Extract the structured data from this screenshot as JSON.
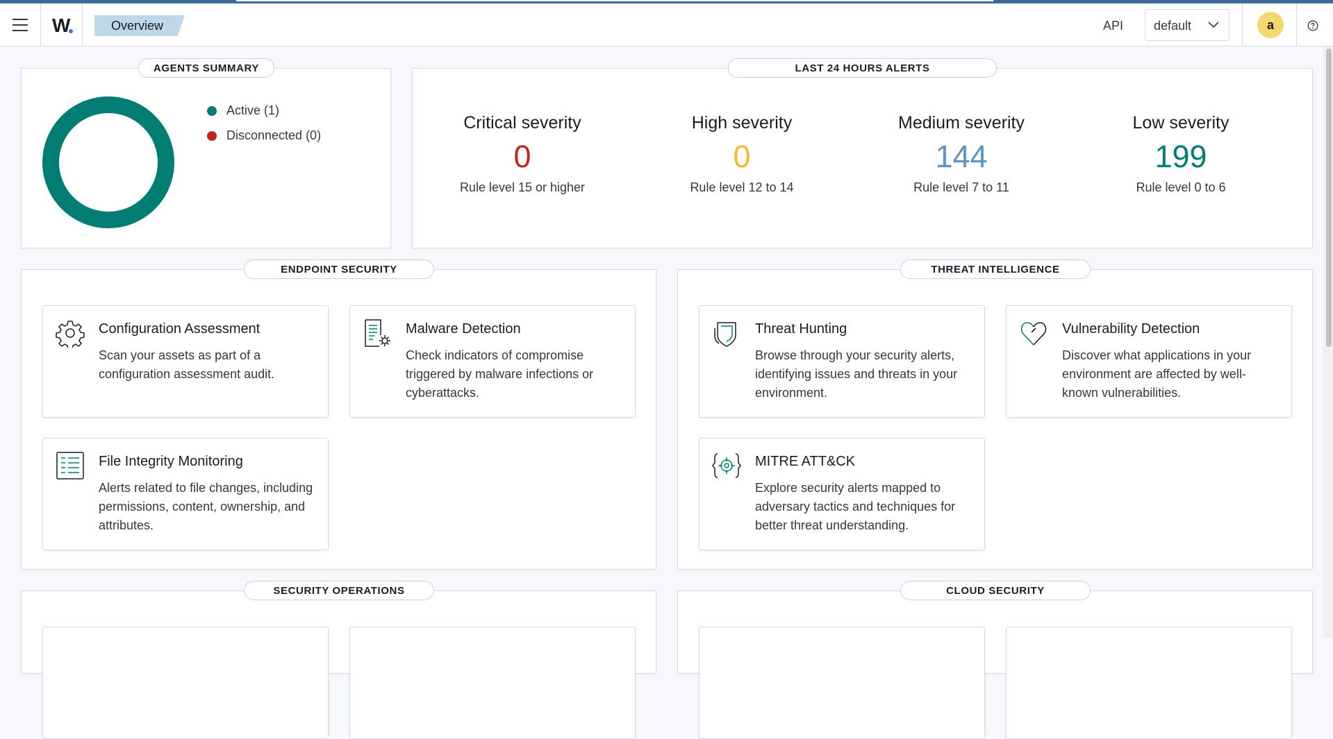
{
  "header": {
    "breadcrumb": "Overview",
    "api_label": "API",
    "api_select": "default",
    "avatar_letter": "a"
  },
  "agents_summary": {
    "title": "AGENTS SUMMARY",
    "legend": [
      {
        "label": "Active (1)",
        "color": "#017d73"
      },
      {
        "label": "Disconnected (0)",
        "color": "#bd271e"
      }
    ],
    "donut": {
      "active": 1,
      "disconnected": 0,
      "color": "#017d73"
    }
  },
  "alerts": {
    "title": "LAST 24 HOURS ALERTS",
    "items": [
      {
        "title": "Critical severity",
        "count": "0",
        "sub": "Rule level 15 or higher",
        "color": "#bd271e"
      },
      {
        "title": "High severity",
        "count": "0",
        "sub": "Rule level 12 to 14",
        "color": "#f5b82e"
      },
      {
        "title": "Medium severity",
        "count": "144",
        "sub": "Rule level 7 to 11",
        "color": "#6092c0"
      },
      {
        "title": "Low severity",
        "count": "199",
        "sub": "Rule level 0 to 6",
        "color": "#017d73"
      }
    ]
  },
  "endpoint_security": {
    "title": "ENDPOINT SECURITY",
    "cards": [
      {
        "title": "Configuration Assessment",
        "desc": "Scan your assets as part of a configuration assessment audit.",
        "icon": "gear-icon"
      },
      {
        "title": "Malware Detection",
        "desc": "Check indicators of compromise triggered by malware infections or cyberattacks.",
        "icon": "document-gear-icon"
      },
      {
        "title": "File Integrity Monitoring",
        "desc": "Alerts related to file changes, including permissions, content, ownership, and attributes.",
        "icon": "list-document-icon"
      }
    ]
  },
  "threat_intelligence": {
    "title": "THREAT INTELLIGENCE",
    "cards": [
      {
        "title": "Threat Hunting",
        "desc": "Browse through your security alerts, identifying issues and threats in your environment.",
        "icon": "shield-icon"
      },
      {
        "title": "Vulnerability Detection",
        "desc": "Discover what applications in your environment are affected by well-known vulnerabilities.",
        "icon": "heart-icon"
      },
      {
        "title": "MITRE ATT&CK",
        "desc": "Explore security alerts mapped to adversary tactics and techniques for better threat understanding.",
        "icon": "crosshair-icon"
      }
    ]
  },
  "security_operations": {
    "title": "SECURITY OPERATIONS"
  },
  "cloud_security": {
    "title": "CLOUD SECURITY"
  }
}
